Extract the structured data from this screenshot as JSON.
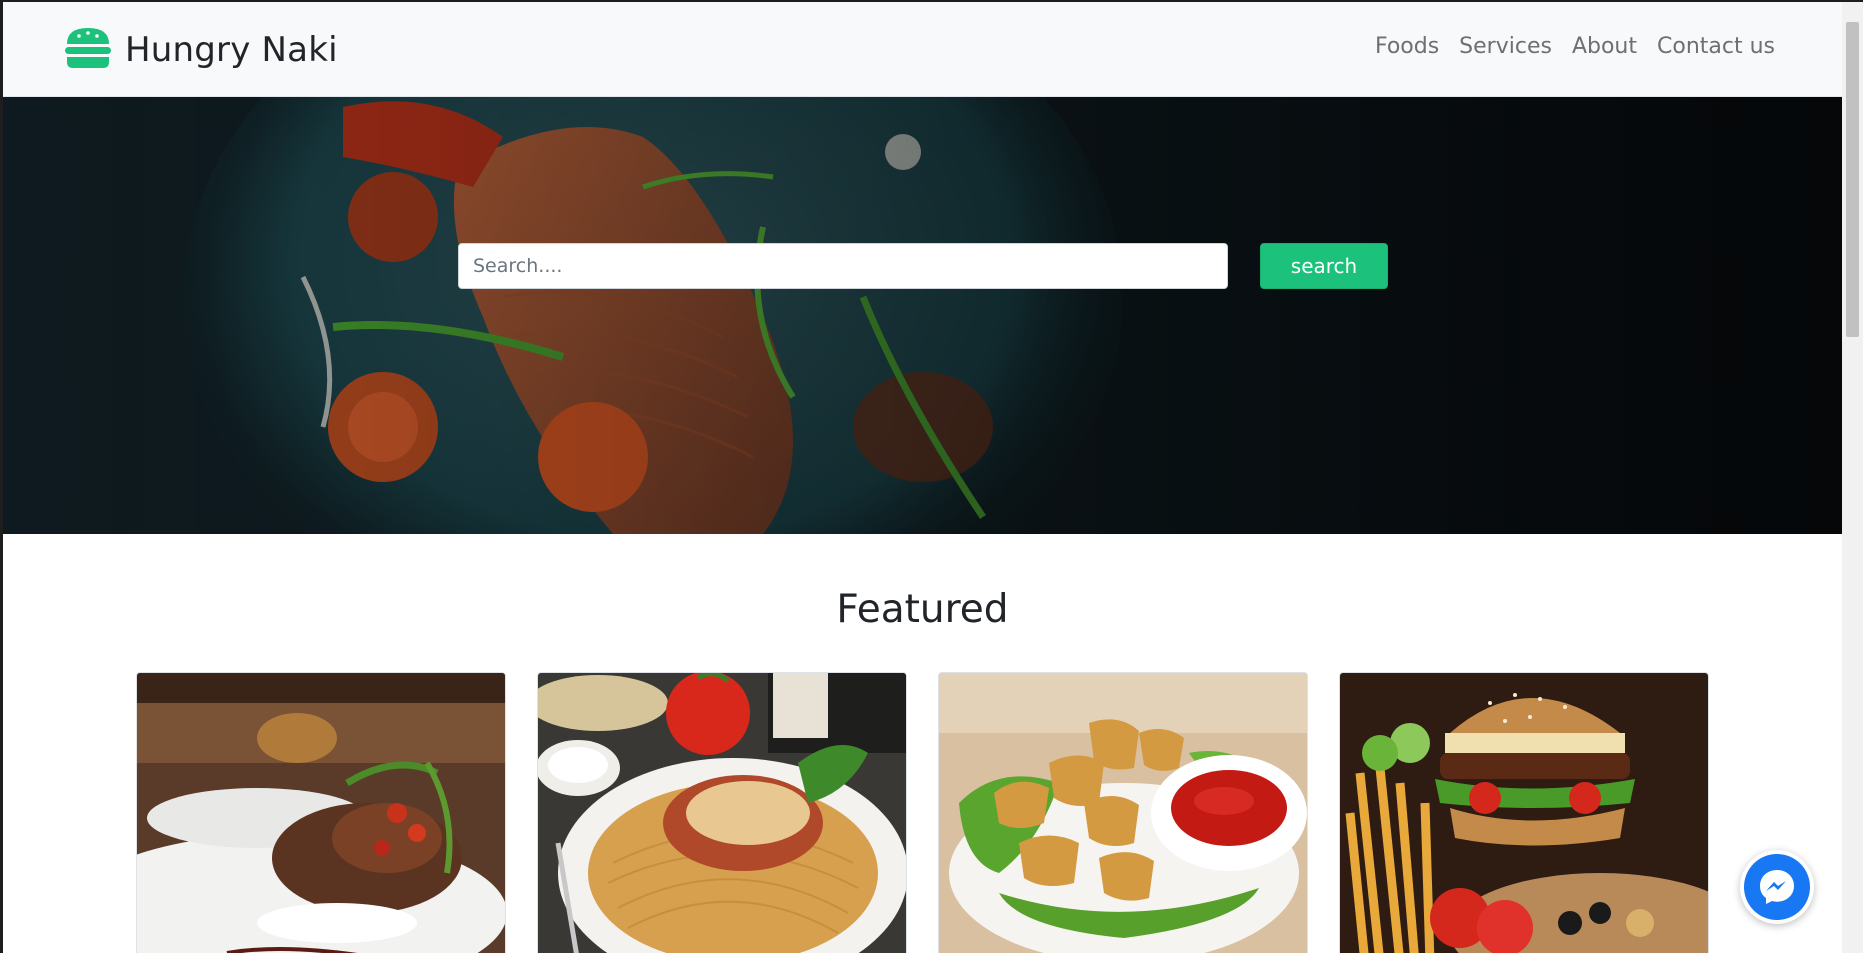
{
  "brand": {
    "name": "Hungry Naki",
    "icon": "burger-icon",
    "color": "#1cc17c"
  },
  "nav": {
    "items": [
      {
        "label": "Foods"
      },
      {
        "label": "Services"
      },
      {
        "label": "About"
      },
      {
        "label": "Contact us"
      }
    ]
  },
  "hero": {
    "search": {
      "placeholder": "Search....",
      "value": ""
    },
    "search_button": "search"
  },
  "featured": {
    "title": "Featured",
    "cards": [
      {
        "image": "plated-steak-dish-image"
      },
      {
        "image": "chicken-parmesan-spaghetti-image"
      },
      {
        "image": "chicken-nuggets-ketchup-image"
      },
      {
        "image": "burger-with-fries-image"
      }
    ]
  },
  "messenger": {
    "icon": "messenger-icon",
    "color": "#1877f2"
  },
  "colors": {
    "accent": "#1cc17c",
    "navbar_bg": "#f8f9fa",
    "text_dark": "#212529"
  }
}
